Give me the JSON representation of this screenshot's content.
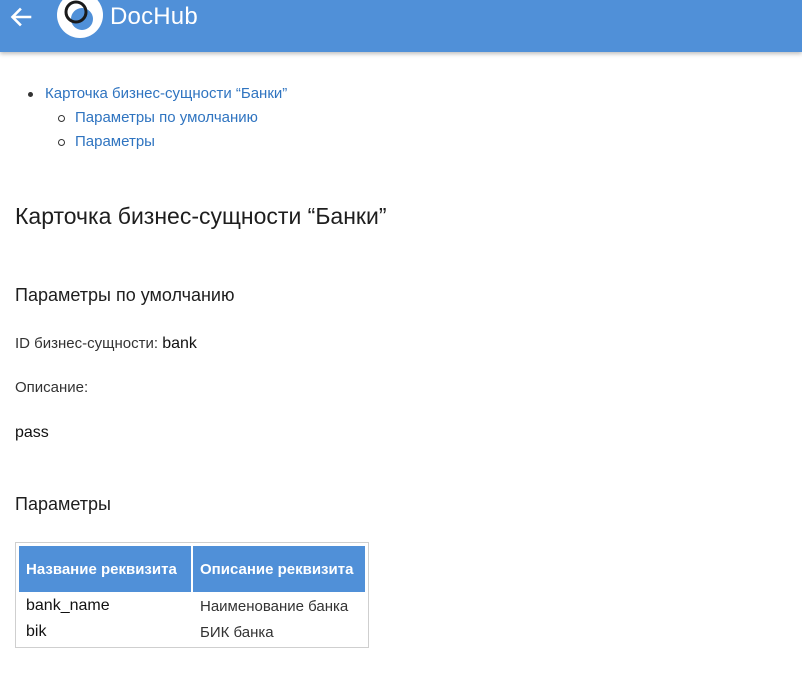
{
  "app": {
    "title": "DocHub",
    "back_icon": "arrow-left-icon",
    "logo_icon": "dochub-logo-icon",
    "bar_color": "#5090d8"
  },
  "toc": {
    "items": [
      {
        "label": "Карточка бизнес-сущности “Банки”",
        "level": 1
      },
      {
        "label": "Параметры по умолчанию",
        "level": 2
      },
      {
        "label": "Параметры",
        "level": 2
      }
    ]
  },
  "document": {
    "title": "Карточка бизнес-сущности “Банки”",
    "defaults_heading": "Параметры по умолчанию",
    "entity_id_label": "ID бизнес-сущности:",
    "entity_id_value": "bank",
    "description_label": "Описание:",
    "description_value": "pass",
    "params_heading": "Параметры"
  },
  "params_table": {
    "headers": [
      "Название реквизита",
      "Описание реквизита"
    ],
    "rows": [
      [
        "bank_name",
        "Наименование банка"
      ],
      [
        "bik",
        "БИК банка"
      ]
    ]
  }
}
